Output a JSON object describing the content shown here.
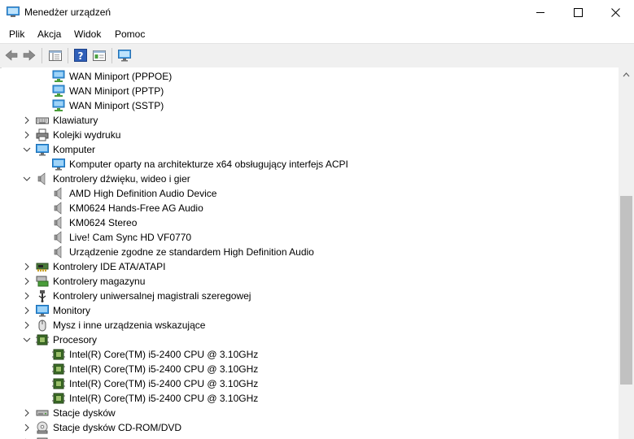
{
  "window": {
    "title": "Menedżer urządzeń"
  },
  "menu": {
    "file": "Plik",
    "action": "Akcja",
    "view": "Widok",
    "help": "Pomoc"
  },
  "tree": [
    {
      "label": "WAN Miniport (PPPOE)",
      "level": 1,
      "icon": "network-adapter-icon"
    },
    {
      "label": "WAN Miniport (PPTP)",
      "level": 1,
      "icon": "network-adapter-icon"
    },
    {
      "label": "WAN Miniport (SSTP)",
      "level": 1,
      "icon": "network-adapter-icon"
    },
    {
      "label": "Klawiatury",
      "level": 0,
      "icon": "keyboard-icon",
      "expanded": false
    },
    {
      "label": "Kolejki wydruku",
      "level": 0,
      "icon": "printer-icon",
      "expanded": false
    },
    {
      "label": "Komputer",
      "level": 0,
      "icon": "computer-icon",
      "expanded": true
    },
    {
      "label": "Komputer oparty na architekturze x64 obsługujący interfejs ACPI",
      "level": 1,
      "icon": "computer-icon"
    },
    {
      "label": "Kontrolery dźwięku, wideo i gier",
      "level": 0,
      "icon": "speaker-icon",
      "expanded": true
    },
    {
      "label": "AMD High Definition Audio Device",
      "level": 1,
      "icon": "speaker-icon"
    },
    {
      "label": "KM0624 Hands-Free AG Audio",
      "level": 1,
      "icon": "speaker-icon"
    },
    {
      "label": "KM0624 Stereo",
      "level": 1,
      "icon": "speaker-icon"
    },
    {
      "label": "Live! Cam Sync HD VF0770",
      "level": 1,
      "icon": "speaker-icon"
    },
    {
      "label": "Urządzenie zgodne ze standardem High Definition Audio",
      "level": 1,
      "icon": "speaker-icon"
    },
    {
      "label": "Kontrolery IDE ATA/ATAPI",
      "level": 0,
      "icon": "ide-controller-icon",
      "expanded": false
    },
    {
      "label": "Kontrolery magazynu",
      "level": 0,
      "icon": "storage-controller-icon",
      "expanded": false
    },
    {
      "label": "Kontrolery uniwersalnej magistrali szeregowej",
      "level": 0,
      "icon": "usb-icon",
      "expanded": false
    },
    {
      "label": "Monitory",
      "level": 0,
      "icon": "monitor-icon",
      "expanded": false
    },
    {
      "label": "Mysz i inne urządzenia wskazujące",
      "level": 0,
      "icon": "mouse-icon",
      "expanded": false
    },
    {
      "label": "Procesory",
      "level": 0,
      "icon": "processor-icon",
      "expanded": true
    },
    {
      "label": "Intel(R) Core(TM) i5-2400 CPU @ 3.10GHz",
      "level": 1,
      "icon": "processor-icon"
    },
    {
      "label": "Intel(R) Core(TM) i5-2400 CPU @ 3.10GHz",
      "level": 1,
      "icon": "processor-icon"
    },
    {
      "label": "Intel(R) Core(TM) i5-2400 CPU @ 3.10GHz",
      "level": 1,
      "icon": "processor-icon"
    },
    {
      "label": "Intel(R) Core(TM) i5-2400 CPU @ 3.10GHz",
      "level": 1,
      "icon": "processor-icon"
    },
    {
      "label": "Stacje dysków",
      "level": 0,
      "icon": "disk-drive-icon",
      "expanded": false
    },
    {
      "label": "Stacje dysków CD-ROM/DVD",
      "level": 0,
      "icon": "cd-rom-icon",
      "expanded": false
    },
    {
      "label": "",
      "level": 0,
      "icon": "device-icon",
      "expanded": false
    }
  ]
}
